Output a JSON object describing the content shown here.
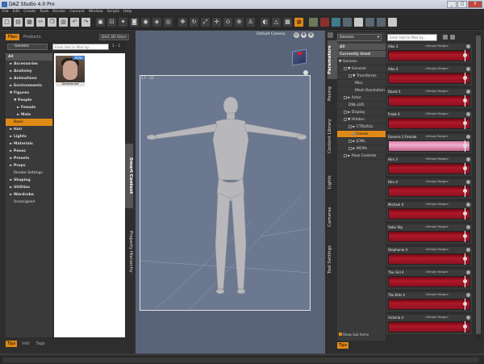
{
  "window": {
    "title": "DAZ Studio 4.0 Pro",
    "controls": [
      "_",
      "□",
      "X"
    ]
  },
  "menu": [
    "File",
    "Edit",
    "Create",
    "Tools",
    "Render",
    "Connect",
    "Window",
    "Scripts",
    "Help"
  ],
  "toolbar": {
    "icons": [
      "new-icon",
      "open-icon",
      "save-icon",
      "cut-icon",
      "copy-icon",
      "paste-icon",
      "undo-icon",
      "redo-icon",
      "group-icon",
      "parent-icon",
      "light-icon",
      "camera-icon",
      "render-icon",
      "render-settings-icon",
      "spot-render-icon",
      "move-icon",
      "rotate-icon",
      "scale-icon",
      "universal-icon",
      "joint-icon",
      "node-icon",
      "pose-icon",
      "surface-icon",
      "geometry-icon",
      "texture-icon",
      "focus-icon",
      "layout-a-icon",
      "layout-b-icon",
      "layout-c-icon",
      "layout-d-icon",
      "layout-e-icon",
      "layout-f-icon",
      "layout-g-icon",
      "layout-h-icon"
    ]
  },
  "left_panel": {
    "tabs": [
      "Files",
      "Products"
    ],
    "active_tab": "Files",
    "store_button": "DAZ 3D Store",
    "content_dropdown": "Genesis",
    "filter_placeholder": "Enter text to filter by...",
    "page": "1 - 1",
    "tree": [
      {
        "label": "All",
        "kind": "all"
      },
      {
        "label": "► Accessories"
      },
      {
        "label": "► Anatomy"
      },
      {
        "label": "► Animations"
      },
      {
        "label": "► Environments"
      },
      {
        "label": "▼ Figures"
      },
      {
        "label": "▼ People",
        "kind": "sub"
      },
      {
        "label": "► Female",
        "kind": "sub2"
      },
      {
        "label": "► Male",
        "kind": "sub2"
      },
      {
        "label": "Basic",
        "kind": "sel"
      },
      {
        "label": "► Hair"
      },
      {
        "label": "► Lights"
      },
      {
        "label": "► Materials"
      },
      {
        "label": "► Poses"
      },
      {
        "label": "► Presets"
      },
      {
        "label": "► Props"
      },
      {
        "label": "Render-Settings",
        "kind": "norm"
      },
      {
        "label": "► Shaping"
      },
      {
        "label": "► Utilities"
      },
      {
        "label": "► Wardrobe"
      },
      {
        "label": "Unassigned",
        "kind": "norm"
      }
    ],
    "thumbnail": {
      "caption": "Genesis.duf",
      "badge": "Actor"
    },
    "side_tabs": [
      "Smart Content",
      "Property Hierarchy"
    ],
    "bottom_tabs": [
      "Tips",
      "Info",
      "Tags"
    ],
    "active_bottom": "Tips"
  },
  "viewport": {
    "camera": "Default Camera",
    "frame_label": "17 - 22"
  },
  "right_panel": {
    "side_tabs": [
      "Parameters",
      "Posing",
      "Content Library",
      "Lights",
      "Cameras",
      "Tool Settings"
    ],
    "active_side": "Parameters",
    "dropdown": "Genesis",
    "filter_placeholder": "Enter text to filter by...",
    "tree_top": [
      {
        "label": "All",
        "kind": "all"
      },
      {
        "label": "Currently Used",
        "kind": "all"
      }
    ],
    "tree": [
      {
        "label": "▼ Genesis",
        "indent": 2
      },
      {
        "label": "▼ General",
        "indent": 8,
        "cb": true
      },
      {
        "label": "▼ Transforms",
        "indent": 14,
        "cb": true
      },
      {
        "label": "Misc",
        "indent": 22
      },
      {
        "label": "Mesh Resolution",
        "indent": 22
      },
      {
        "label": "► Actor",
        "indent": 8,
        "cb": true
      },
      {
        "label": "DNL-LVD",
        "indent": 14
      },
      {
        "label": "► Display",
        "indent": 8,
        "cb": true
      },
      {
        "label": "▼ Hidden",
        "indent": 8,
        "cb": true
      },
      {
        "label": "► CTRLRGs",
        "indent": 14,
        "cb": true
      },
      {
        "label": "Clones",
        "indent": 18,
        "kind": "sel",
        "cb": true
      },
      {
        "label": "► JCMs",
        "indent": 14,
        "cb": true
      },
      {
        "label": "► MCMs",
        "indent": 14,
        "cb": true
      },
      {
        "label": "► Pose Controls",
        "indent": 8,
        "cb": true
      }
    ],
    "show_sub_items": "Show Sub Items",
    "sliders": [
      {
        "name": "Aiko 3",
        "range": "<Empty Range>"
      },
      {
        "name": "Aiko 4",
        "range": "<Empty Range>"
      },
      {
        "name": "David 3",
        "range": "<Empty Range>"
      },
      {
        "name": "Freak 4",
        "range": "<Empty Range>"
      },
      {
        "name": "Genesis 2 Female",
        "range": "<Empty Range>",
        "highlight": true
      },
      {
        "name": "Hiro 3",
        "range": "<Empty Range>"
      },
      {
        "name": "Hiro 4",
        "range": "<Empty Range>"
      },
      {
        "name": "Michael 4",
        "range": "<Empty Range>"
      },
      {
        "name": "Sabu Sky",
        "range": "<Empty Range>"
      },
      {
        "name": "Stephanie 4",
        "range": "<Empty Range>"
      },
      {
        "name": "The Girl 4",
        "range": "<Empty Range>"
      },
      {
        "name": "The Kids 4",
        "range": "<Empty Range>"
      },
      {
        "name": "Victoria 4",
        "range": "<Empty Range>"
      }
    ],
    "bottom_tab": "Tips"
  },
  "colors": {
    "accent": "#e08a16",
    "slider_red": "#b01828",
    "viewport": "#5a6478"
  }
}
